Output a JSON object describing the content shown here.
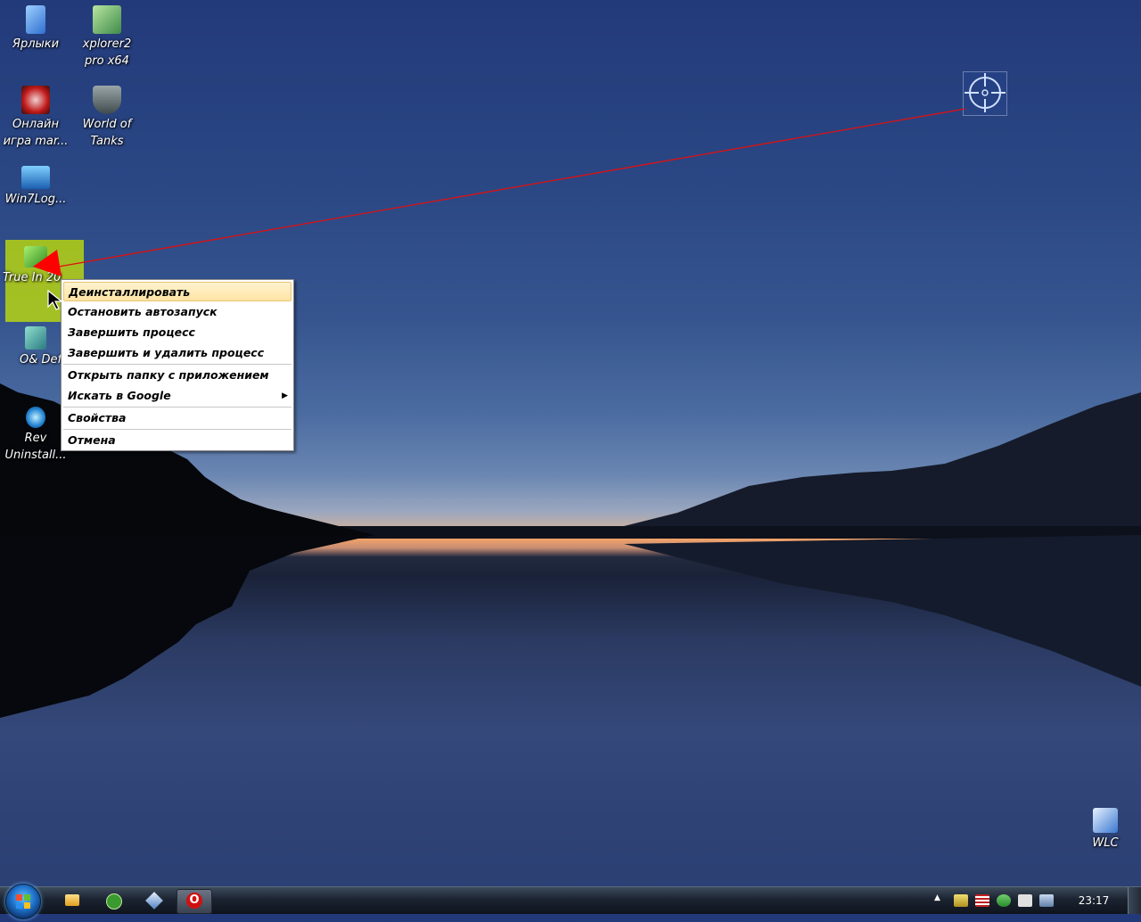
{
  "desktop": {
    "icons": [
      {
        "label": "Ярлыки"
      },
      {
        "label": "xplorer2 pro x64"
      },
      {
        "label": "Онлайн игра mar..."
      },
      {
        "label": "World of Tanks"
      },
      {
        "label": "Win7Log..."
      },
      {
        "label": "True In 20"
      },
      {
        "label": "O& Def"
      },
      {
        "label": "Rev Uninstall..."
      },
      {
        "label": "WLC"
      }
    ]
  },
  "context_menu": {
    "items": [
      "Деинсталлировать",
      "Остановить автозапуск",
      "Завершить процесс",
      "Завершить и удалить процесс",
      "Открыть папку с приложением",
      "Искать в Google",
      "Свойства",
      "Отмена"
    ],
    "submenu_arrow": "▶"
  },
  "taskbar": {
    "clock": "23:17",
    "tray_expand": "▲",
    "opera_glyph": "O"
  },
  "colors": {
    "highlight": "#c8e600",
    "annotation_arrow": "#ff0000",
    "menu_selected": "#ffe3a3"
  }
}
